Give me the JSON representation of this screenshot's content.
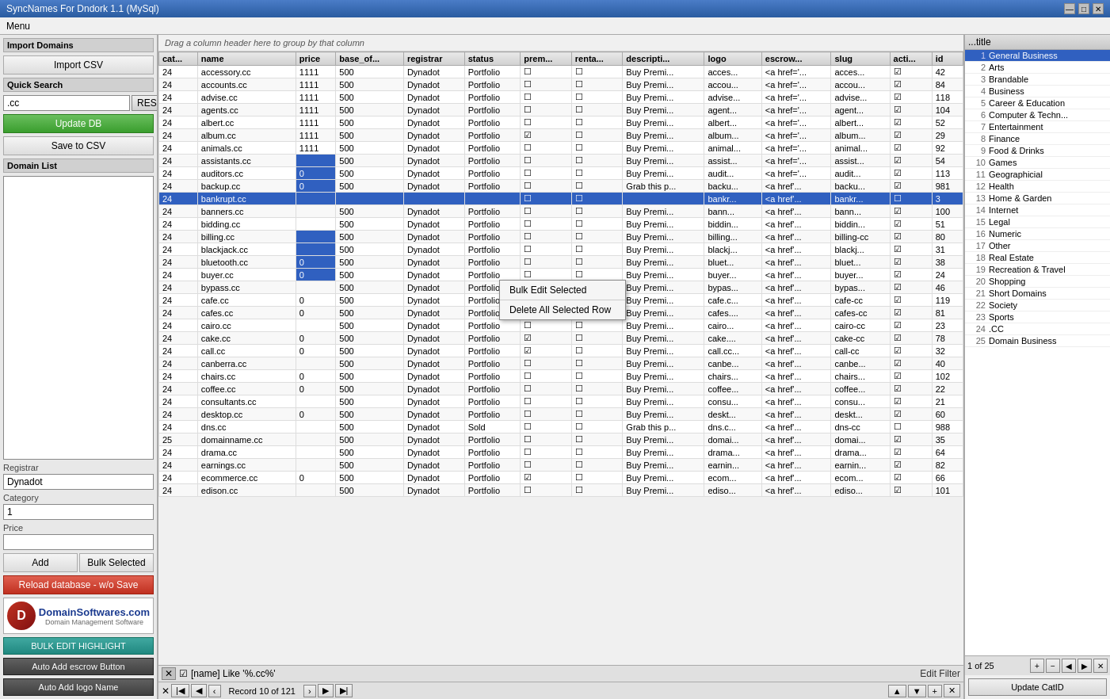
{
  "app": {
    "title": "SyncNames For Dndork  1.1 (MySql)",
    "menu_label": "Menu"
  },
  "titlebar": {
    "minimize": "—",
    "maximize": "□",
    "close": "✕"
  },
  "left_panel": {
    "import_section": "Import Domains",
    "import_csv_btn": "Import CSV",
    "quick_search_section": "Quick Search",
    "search_value": ".cc",
    "reset_btn": "RESET",
    "update_db_btn": "Update DB",
    "save_csv_btn": "Save to CSV",
    "domain_list_section": "Domain List",
    "registrar_label": "Registrar",
    "registrar_value": "Dynadot",
    "category_label": "Category",
    "category_value": "1",
    "price_label": "Price",
    "price_value": "",
    "add_btn": "Add",
    "bulk_selected_btn": "Bulk Selected",
    "reload_btn": "Reload database - w/o Save",
    "bulk_highlight_btn": "BULK EDIT HIGHLIGHT",
    "auto_escrow_btn": "Auto Add escrow Button",
    "auto_logo_btn": "Auto Add logo Name"
  },
  "grid": {
    "drag_hint": "Drag a column header here to group by that column",
    "columns": [
      "cat...",
      "name",
      "price",
      "base_of...",
      "registrar",
      "status",
      "prem...",
      "renta...",
      "descripti...",
      "logo",
      "escrow...",
      "slug",
      "acti...",
      "id"
    ],
    "rows": [
      {
        "cat": "24",
        "name": "accessory.cc",
        "price": "1111",
        "base": "500",
        "registrar": "Dynadot",
        "status": "Portfolio",
        "prem": false,
        "rent": false,
        "desc": "Buy Premi...",
        "logo": "acces...",
        "escrow": "<a href='...",
        "slug": "acces...",
        "act": true,
        "id": "42"
      },
      {
        "cat": "24",
        "name": "accounts.cc",
        "price": "1111",
        "base": "500",
        "registrar": "Dynadot",
        "status": "Portfolio",
        "prem": false,
        "rent": false,
        "desc": "Buy Premi...",
        "logo": "accou...",
        "escrow": "<a href='...",
        "slug": "accou...",
        "act": true,
        "id": "84"
      },
      {
        "cat": "24",
        "name": "advise.cc",
        "price": "1111",
        "base": "500",
        "registrar": "Dynadot",
        "status": "Portfolio",
        "prem": false,
        "rent": false,
        "desc": "Buy Premi...",
        "logo": "advise...",
        "escrow": "<a href='...",
        "slug": "advise...",
        "act": true,
        "id": "118"
      },
      {
        "cat": "24",
        "name": "agents.cc",
        "price": "1111",
        "base": "500",
        "registrar": "Dynadot",
        "status": "Portfolio",
        "prem": false,
        "rent": false,
        "desc": "Buy Premi...",
        "logo": "agent...",
        "escrow": "<a href='...",
        "slug": "agent...",
        "act": true,
        "id": "104"
      },
      {
        "cat": "24",
        "name": "albert.cc",
        "price": "1111",
        "base": "500",
        "registrar": "Dynadot",
        "status": "Portfolio",
        "prem": false,
        "rent": false,
        "desc": "Buy Premi...",
        "logo": "albert...",
        "escrow": "<a href='...",
        "slug": "albert...",
        "act": true,
        "id": "52"
      },
      {
        "cat": "24",
        "name": "album.cc",
        "price": "1111",
        "base": "500",
        "registrar": "Dynadot",
        "status": "Portfolio",
        "prem": true,
        "rent": false,
        "desc": "Buy Premi...",
        "logo": "album...",
        "escrow": "<a href='...",
        "slug": "album...",
        "act": true,
        "id": "29"
      },
      {
        "cat": "24",
        "name": "animals.cc",
        "price": "1111",
        "base": "500",
        "registrar": "Dynadot",
        "status": "Portfolio",
        "prem": false,
        "rent": false,
        "desc": "Buy Premi...",
        "logo": "animal...",
        "escrow": "<a href='...",
        "slug": "animal...",
        "act": true,
        "id": "92"
      },
      {
        "cat": "24",
        "name": "assistants.cc",
        "price": "",
        "base": "500",
        "registrar": "Dynadot",
        "status": "Portfolio",
        "prem": false,
        "rent": false,
        "desc": "Buy Premi...",
        "logo": "assist...",
        "escrow": "<a href='...",
        "slug": "assist...",
        "act": true,
        "id": "54"
      },
      {
        "cat": "24",
        "name": "auditors.cc",
        "price": "0",
        "base": "500",
        "registrar": "Dynadot",
        "status": "Portfolio",
        "prem": false,
        "rent": false,
        "desc": "Buy Premi...",
        "logo": "audit...",
        "escrow": "<a href='...",
        "slug": "audit...",
        "act": true,
        "id": "113"
      },
      {
        "cat": "24",
        "name": "backup.cc",
        "price": "0",
        "base": "500",
        "registrar": "Dynadot",
        "status": "Portfolio",
        "prem": false,
        "rent": false,
        "desc": "Grab this p...",
        "logo": "backu...",
        "escrow": "<a href'...",
        "slug": "backu...",
        "act": true,
        "id": "981"
      },
      {
        "cat": "24",
        "name": "bankrupt.cc",
        "price": "",
        "base": "",
        "registrar": "",
        "status": "",
        "prem": false,
        "rent": false,
        "desc": "",
        "logo": "bankr...",
        "escrow": "<a href'...",
        "slug": "bankr...",
        "act": false,
        "id": "3",
        "selected": true
      },
      {
        "cat": "24",
        "name": "banners.cc",
        "price": "",
        "base": "500",
        "registrar": "Dynadot",
        "status": "Portfolio",
        "prem": false,
        "rent": false,
        "desc": "Buy Premi...",
        "logo": "bann...",
        "escrow": "<a href'...",
        "slug": "bann...",
        "act": true,
        "id": "100"
      },
      {
        "cat": "24",
        "name": "bidding.cc",
        "price": "",
        "base": "500",
        "registrar": "Dynadot",
        "status": "Portfolio",
        "prem": false,
        "rent": false,
        "desc": "Buy Premi...",
        "logo": "biddin...",
        "escrow": "<a href'...",
        "slug": "biddin...",
        "act": true,
        "id": "51"
      },
      {
        "cat": "24",
        "name": "billing.cc",
        "price": "",
        "base": "500",
        "registrar": "Dynadot",
        "status": "Portfolio",
        "prem": false,
        "rent": false,
        "desc": "Buy Premi...",
        "logo": "billing...",
        "escrow": "<a href'...",
        "slug": "billing-cc",
        "act": true,
        "id": "80"
      },
      {
        "cat": "24",
        "name": "blackjack.cc",
        "price": "",
        "base": "500",
        "registrar": "Dynadot",
        "status": "Portfolio",
        "prem": false,
        "rent": false,
        "desc": "Buy Premi...",
        "logo": "blackj...",
        "escrow": "<a href'...",
        "slug": "blackj...",
        "act": true,
        "id": "31"
      },
      {
        "cat": "24",
        "name": "bluetooth.cc",
        "price": "0",
        "base": "500",
        "registrar": "Dynadot",
        "status": "Portfolio",
        "prem": false,
        "rent": false,
        "desc": "Buy Premi...",
        "logo": "bluet...",
        "escrow": "<a href'...",
        "slug": "bluet...",
        "act": true,
        "id": "38"
      },
      {
        "cat": "24",
        "name": "buyer.cc",
        "price": "0",
        "base": "500",
        "registrar": "Dynadot",
        "status": "Portfolio",
        "prem": false,
        "rent": false,
        "desc": "Buy Premi...",
        "logo": "buyer...",
        "escrow": "<a href'...",
        "slug": "buyer...",
        "act": true,
        "id": "24"
      },
      {
        "cat": "24",
        "name": "bypass.cc",
        "price": "",
        "base": "500",
        "registrar": "Dynadot",
        "status": "Portfolio",
        "prem": false,
        "rent": false,
        "desc": "Buy Premi...",
        "logo": "bypas...",
        "escrow": "<a href'...",
        "slug": "bypas...",
        "act": true,
        "id": "46"
      },
      {
        "cat": "24",
        "name": "cafe.cc",
        "price": "0",
        "base": "500",
        "registrar": "Dynadot",
        "status": "Portfolio",
        "prem": true,
        "rent": false,
        "desc": "Buy Premi...",
        "logo": "cafe.c...",
        "escrow": "<a href'...",
        "slug": "cafe-cc",
        "act": true,
        "id": "119"
      },
      {
        "cat": "24",
        "name": "cafes.cc",
        "price": "0",
        "base": "500",
        "registrar": "Dynadot",
        "status": "Portfolio",
        "prem": false,
        "rent": false,
        "desc": "Buy Premi...",
        "logo": "cafes....",
        "escrow": "<a href'...",
        "slug": "cafes-cc",
        "act": true,
        "id": "81"
      },
      {
        "cat": "24",
        "name": "cairo.cc",
        "price": "",
        "base": "500",
        "registrar": "Dynadot",
        "status": "Portfolio",
        "prem": false,
        "rent": false,
        "desc": "Buy Premi...",
        "logo": "cairo...",
        "escrow": "<a href'...",
        "slug": "cairo-cc",
        "act": true,
        "id": "23"
      },
      {
        "cat": "24",
        "name": "cake.cc",
        "price": "0",
        "base": "500",
        "registrar": "Dynadot",
        "status": "Portfolio",
        "prem": true,
        "rent": false,
        "desc": "Buy Premi...",
        "logo": "cake....",
        "escrow": "<a href'...",
        "slug": "cake-cc",
        "act": true,
        "id": "78"
      },
      {
        "cat": "24",
        "name": "call.cc",
        "price": "0",
        "base": "500",
        "registrar": "Dynadot",
        "status": "Portfolio",
        "prem": true,
        "rent": false,
        "desc": "Buy Premi...",
        "logo": "call.cc...",
        "escrow": "<a href'...",
        "slug": "call-cc",
        "act": true,
        "id": "32"
      },
      {
        "cat": "24",
        "name": "canberra.cc",
        "price": "",
        "base": "500",
        "registrar": "Dynadot",
        "status": "Portfolio",
        "prem": false,
        "rent": false,
        "desc": "Buy Premi...",
        "logo": "canbe...",
        "escrow": "<a href'...",
        "slug": "canbe...",
        "act": true,
        "id": "40"
      },
      {
        "cat": "24",
        "name": "chairs.cc",
        "price": "0",
        "base": "500",
        "registrar": "Dynadot",
        "status": "Portfolio",
        "prem": false,
        "rent": false,
        "desc": "Buy Premi...",
        "logo": "chairs...",
        "escrow": "<a href'...",
        "slug": "chairs...",
        "act": true,
        "id": "102"
      },
      {
        "cat": "24",
        "name": "coffee.cc",
        "price": "0",
        "base": "500",
        "registrar": "Dynadot",
        "status": "Portfolio",
        "prem": false,
        "rent": false,
        "desc": "Buy Premi...",
        "logo": "coffee...",
        "escrow": "<a href'...",
        "slug": "coffee...",
        "act": true,
        "id": "22"
      },
      {
        "cat": "24",
        "name": "consultants.cc",
        "price": "",
        "base": "500",
        "registrar": "Dynadot",
        "status": "Portfolio",
        "prem": false,
        "rent": false,
        "desc": "Buy Premi...",
        "logo": "consu...",
        "escrow": "<a href'...",
        "slug": "consu...",
        "act": true,
        "id": "21"
      },
      {
        "cat": "24",
        "name": "desktop.cc",
        "price": "0",
        "base": "500",
        "registrar": "Dynadot",
        "status": "Portfolio",
        "prem": false,
        "rent": false,
        "desc": "Buy Premi...",
        "logo": "deskt...",
        "escrow": "<a href'...",
        "slug": "deskt...",
        "act": true,
        "id": "60"
      },
      {
        "cat": "24",
        "name": "dns.cc",
        "price": "",
        "base": "500",
        "registrar": "Dynadot",
        "status": "Sold",
        "prem": false,
        "rent": false,
        "desc": "Grab this p...",
        "logo": "dns.c...",
        "escrow": "<a href'...",
        "slug": "dns-cc",
        "act": false,
        "id": "988"
      },
      {
        "cat": "25",
        "name": "domainname.cc",
        "price": "",
        "base": "500",
        "registrar": "Dynadot",
        "status": "Portfolio",
        "prem": false,
        "rent": false,
        "desc": "Buy Premi...",
        "logo": "domai...",
        "escrow": "<a href'...",
        "slug": "domai...",
        "act": true,
        "id": "35"
      },
      {
        "cat": "24",
        "name": "drama.cc",
        "price": "",
        "base": "500",
        "registrar": "Dynadot",
        "status": "Portfolio",
        "prem": false,
        "rent": false,
        "desc": "Buy Premi...",
        "logo": "drama...",
        "escrow": "<a href'...",
        "slug": "drama...",
        "act": true,
        "id": "64"
      },
      {
        "cat": "24",
        "name": "earnings.cc",
        "price": "",
        "base": "500",
        "registrar": "Dynadot",
        "status": "Portfolio",
        "prem": false,
        "rent": false,
        "desc": "Buy Premi...",
        "logo": "earnin...",
        "escrow": "<a href'...",
        "slug": "earnin...",
        "act": true,
        "id": "82"
      },
      {
        "cat": "24",
        "name": "ecommerce.cc",
        "price": "0",
        "base": "500",
        "registrar": "Dynadot",
        "status": "Portfolio",
        "prem": true,
        "rent": false,
        "desc": "Buy Premi...",
        "logo": "ecom...",
        "escrow": "<a href'...",
        "slug": "ecom...",
        "act": true,
        "id": "66"
      },
      {
        "cat": "24",
        "name": "edison.cc",
        "price": "",
        "base": "500",
        "registrar": "Dynadot",
        "status": "Portfolio",
        "prem": false,
        "rent": false,
        "desc": "Buy Premi...",
        "logo": "ediso...",
        "escrow": "<a href'...",
        "slug": "ediso...",
        "act": true,
        "id": "101"
      }
    ],
    "context_menu": {
      "bulk_edit": "Bulk Edit Selected",
      "delete_rows": "Delete All Selected Row"
    },
    "filter_text": "[name] Like '%.cc%'",
    "nav": {
      "record_label": "Record 10 of 121"
    }
  },
  "right_panel": {
    "header": {
      "expand_icon": "...",
      "title_col": "title"
    },
    "page_info": "1 of 25",
    "update_catid_btn": "Update CatID",
    "categories": [
      {
        "num": "1",
        "label": "General Business",
        "selected": true
      },
      {
        "num": "2",
        "label": "Arts"
      },
      {
        "num": "3",
        "label": "Brandable"
      },
      {
        "num": "4",
        "label": "Business"
      },
      {
        "num": "5",
        "label": "Career & Education"
      },
      {
        "num": "6",
        "label": "Computer & Techn..."
      },
      {
        "num": "7",
        "label": "Entertainment"
      },
      {
        "num": "8",
        "label": "Finance"
      },
      {
        "num": "9",
        "label": "Food & Drinks"
      },
      {
        "num": "10",
        "label": "Games"
      },
      {
        "num": "11",
        "label": "Geographicial"
      },
      {
        "num": "12",
        "label": "Health"
      },
      {
        "num": "13",
        "label": "Home & Garden"
      },
      {
        "num": "14",
        "label": "Internet"
      },
      {
        "num": "15",
        "label": "Legal"
      },
      {
        "num": "16",
        "label": "Numeric"
      },
      {
        "num": "17",
        "label": "Other"
      },
      {
        "num": "18",
        "label": "Real Estate"
      },
      {
        "num": "19",
        "label": "Recreation & Travel"
      },
      {
        "num": "20",
        "label": "Shopping"
      },
      {
        "num": "21",
        "label": "Short Domains"
      },
      {
        "num": "22",
        "label": "Society"
      },
      {
        "num": "23",
        "label": "Sports"
      },
      {
        "num": "24",
        "label": ".CC"
      },
      {
        "num": "25",
        "label": "Domain Business"
      }
    ]
  }
}
